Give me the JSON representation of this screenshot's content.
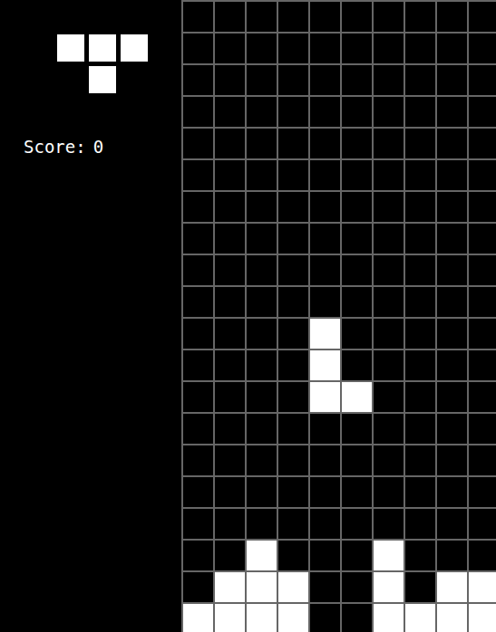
{
  "next_piece": {
    "cells": [
      [
        1,
        1,
        1
      ],
      [
        0,
        1,
        0
      ]
    ]
  },
  "score": {
    "label": "Score:",
    "value": "0"
  },
  "board": {
    "rows": [
      [
        0,
        0,
        0,
        0,
        0,
        0,
        0,
        0,
        0,
        0
      ],
      [
        0,
        0,
        0,
        0,
        0,
        0,
        0,
        0,
        0,
        0
      ],
      [
        0,
        0,
        0,
        0,
        0,
        0,
        0,
        0,
        0,
        0
      ],
      [
        0,
        0,
        0,
        0,
        0,
        0,
        0,
        0,
        0,
        0
      ],
      [
        0,
        0,
        0,
        0,
        0,
        0,
        0,
        0,
        0,
        0
      ],
      [
        0,
        0,
        0,
        0,
        0,
        0,
        0,
        0,
        0,
        0
      ],
      [
        0,
        0,
        0,
        0,
        0,
        0,
        0,
        0,
        0,
        0
      ],
      [
        0,
        0,
        0,
        0,
        0,
        0,
        0,
        0,
        0,
        0
      ],
      [
        0,
        0,
        0,
        0,
        0,
        0,
        0,
        0,
        0,
        0
      ],
      [
        0,
        0,
        0,
        0,
        0,
        0,
        0,
        0,
        0,
        0
      ],
      [
        0,
        0,
        0,
        0,
        1,
        0,
        0,
        0,
        0,
        0
      ],
      [
        0,
        0,
        0,
        0,
        1,
        0,
        0,
        0,
        0,
        0
      ],
      [
        0,
        0,
        0,
        0,
        1,
        1,
        0,
        0,
        0,
        0
      ],
      [
        0,
        0,
        0,
        0,
        0,
        0,
        0,
        0,
        0,
        0
      ],
      [
        0,
        0,
        0,
        0,
        0,
        0,
        0,
        0,
        0,
        0
      ],
      [
        0,
        0,
        0,
        0,
        0,
        0,
        0,
        0,
        0,
        0
      ],
      [
        0,
        0,
        0,
        0,
        0,
        0,
        0,
        0,
        0,
        0
      ],
      [
        0,
        0,
        1,
        0,
        0,
        0,
        1,
        0,
        0,
        0
      ],
      [
        0,
        1,
        1,
        1,
        0,
        0,
        1,
        0,
        1,
        1
      ],
      [
        1,
        1,
        1,
        1,
        0,
        0,
        1,
        1,
        1,
        1
      ]
    ]
  }
}
